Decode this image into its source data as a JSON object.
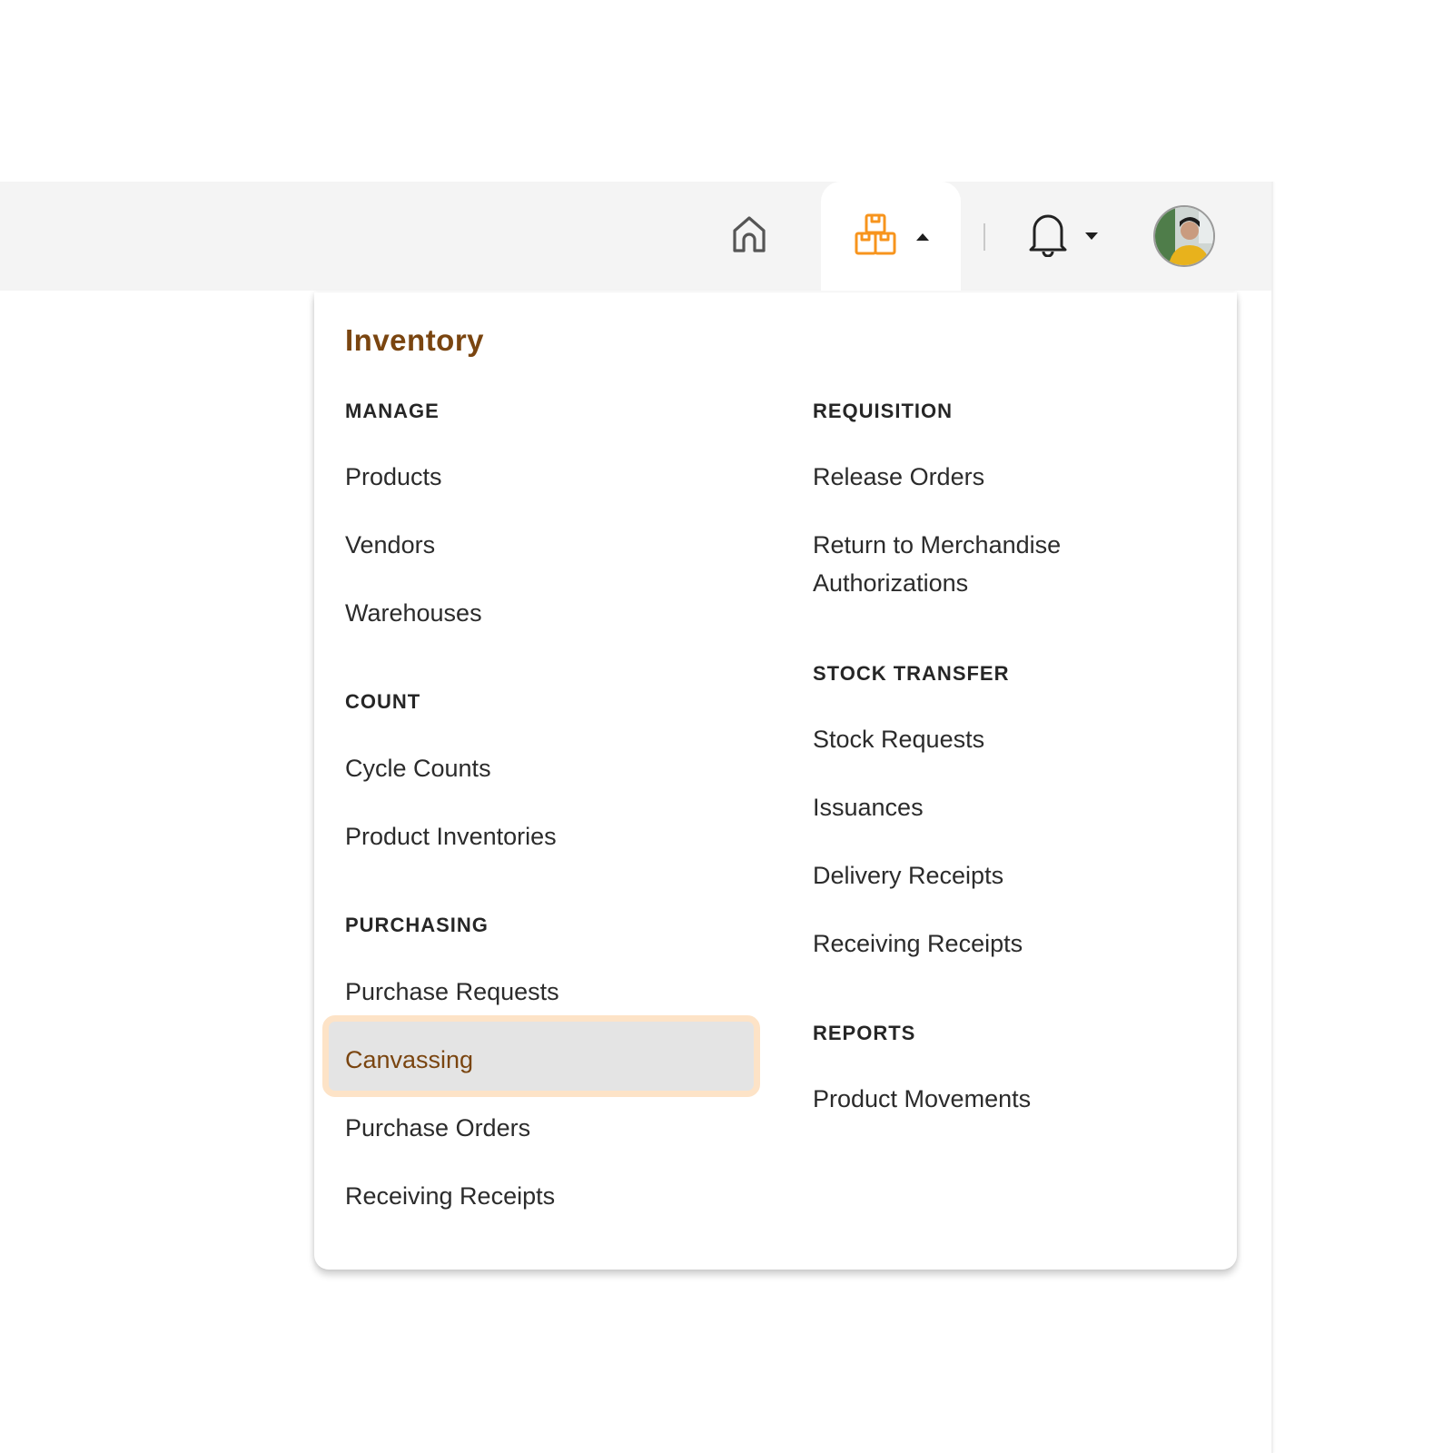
{
  "topbar": {
    "icons": {
      "home": "home-icon",
      "inventory": "boxes-icon",
      "notifications": "bell-icon",
      "avatar": "user-avatar"
    },
    "inventory_caret": "caret-up-icon",
    "notifications_caret": "caret-down-icon",
    "accent_color": "#f7941d"
  },
  "menu": {
    "title": "Inventory",
    "title_color": "#7a4510",
    "left_column": {
      "sections": [
        {
          "heading": "MANAGE",
          "items": [
            "Products",
            "Vendors",
            "Warehouses"
          ]
        },
        {
          "heading": "COUNT",
          "items": [
            "Cycle Counts",
            "Product Inventories"
          ]
        },
        {
          "heading": "PURCHASING",
          "items": [
            "Purchase Requests",
            "Canvassing",
            "Purchase Orders",
            "Receiving Receipts"
          ]
        }
      ]
    },
    "right_column": {
      "sections": [
        {
          "heading": "REQUISITION",
          "items": [
            "Release Orders",
            "Return to Merchandise Authorizations"
          ]
        },
        {
          "heading": "STOCK TRANSFER",
          "items": [
            "Stock Requests",
            "Issuances",
            "Delivery Receipts",
            "Receiving Receipts"
          ]
        },
        {
          "heading": "REPORTS",
          "items": [
            "Product Movements"
          ]
        }
      ]
    },
    "active_item": "Canvassing",
    "active_bg": "#e4e4e4",
    "active_border": "#fde3c7"
  },
  "labels": {
    "rma_line1": "Return to Merchandise",
    "rma_line2": "Authorizations"
  }
}
